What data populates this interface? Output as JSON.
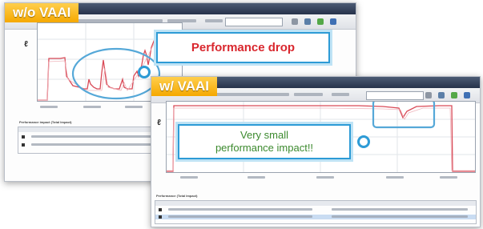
{
  "back_window": {
    "tag": "w/o VAAI",
    "callout": "Performance drop",
    "section_label": "Performance impact (Total Impact)"
  },
  "front_window": {
    "tag": "w/ VAAI",
    "callout_line1": "Very small",
    "callout_line2": "performance impact!!",
    "section_label": "Performance (Total Impact)"
  },
  "colors": {
    "callout_text_red": "#d9272e",
    "callout_text_green": "#3c8a2e",
    "callout_border": "#2d9bd6",
    "tag_bg": "#f5a800",
    "series_line": "#d94a57"
  },
  "icons": [
    "refresh-icon",
    "export-icon",
    "settings-icon",
    "help-icon"
  ]
}
